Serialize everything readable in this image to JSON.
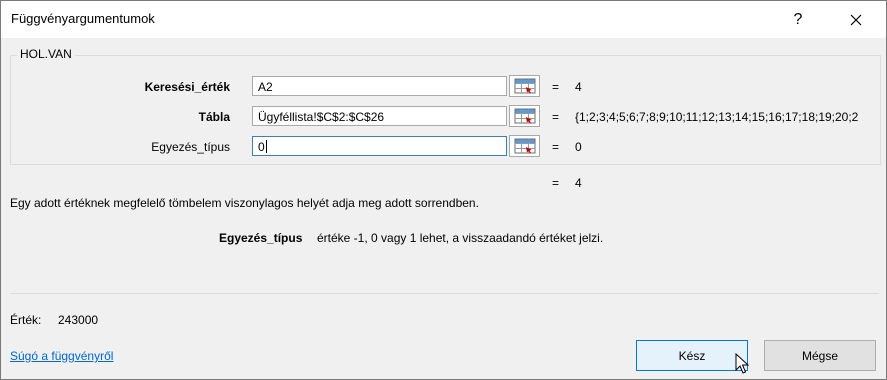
{
  "window": {
    "title": "Függvényargumentumok",
    "help_glyph": "?",
    "close_icon": "close-icon"
  },
  "function": {
    "name": "HOL.VAN",
    "args": [
      {
        "label": "Keresési_érték",
        "value": "A2",
        "result": "4",
        "bold": true,
        "focused": false
      },
      {
        "label": "Tábla",
        "value": "Ügyféllista!$C$2:$C$26",
        "result": "{1;2;3;4;5;6;7;8;9;10;11;12;13;14;15;16;17;18;19;20;2",
        "bold": true,
        "focused": false
      },
      {
        "label": "Egyezés_típus",
        "value": "0",
        "result": "0",
        "bold": false,
        "focused": true
      }
    ],
    "eq_sign": "=",
    "result": "4",
    "description": "Egy adott értéknek megfelelő tömbelem viszonylagos helyét adja meg adott sorrendben.",
    "param_name": "Egyezés_típus",
    "param_description": "értéke -1, 0 vagy 1 lehet, a visszaadandó értéket jelzi."
  },
  "footer": {
    "value_label": "Érték:",
    "value": "243000",
    "help_link": "Súgó a függvényről",
    "ok_label": "Kész",
    "cancel_label": "Mégse"
  },
  "colors": {
    "accent": "#0078d7",
    "link": "#0066cc",
    "dialog_bg": "#f0f0f0"
  }
}
